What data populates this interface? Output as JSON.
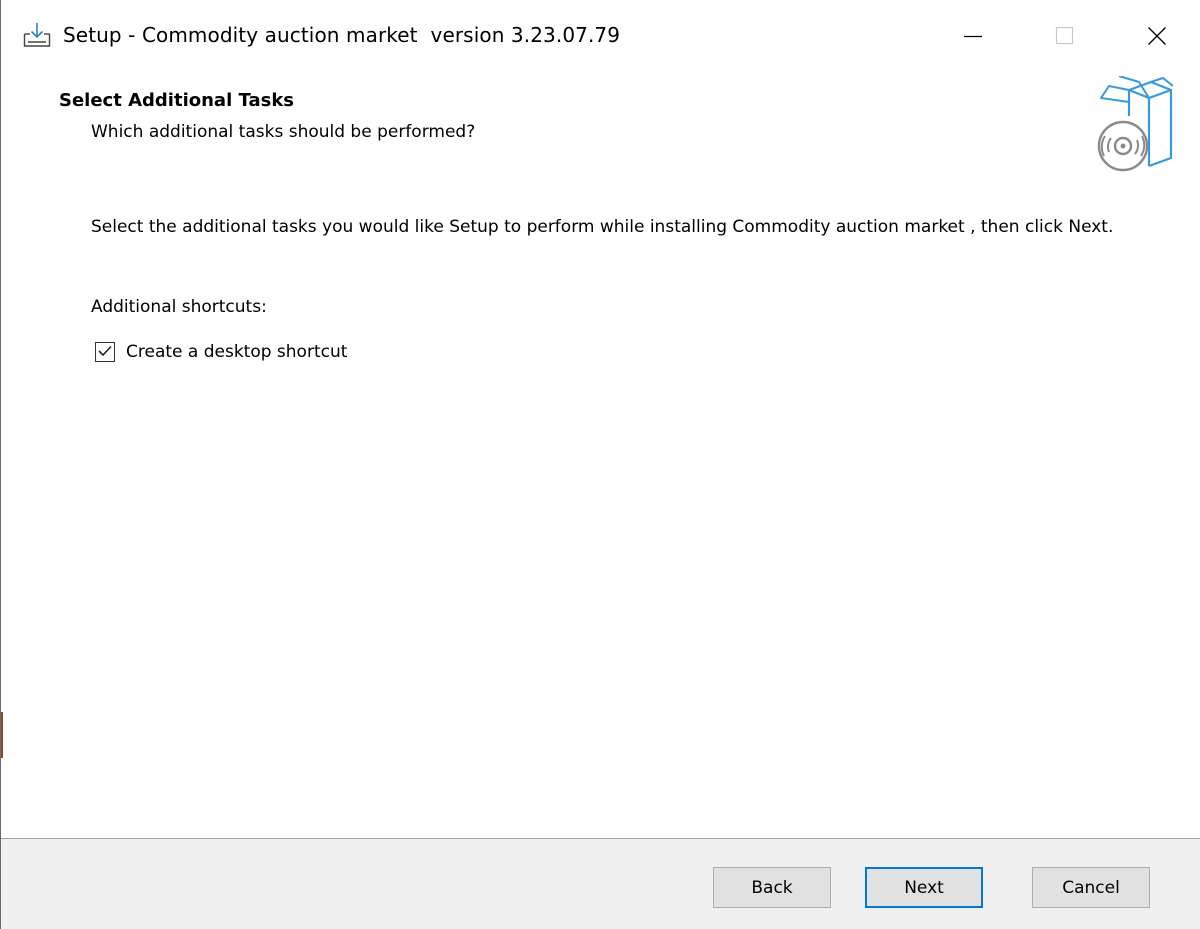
{
  "window": {
    "title": "Setup - Commodity auction market  version 3.23.07.79",
    "controls": {
      "minimize": "minimize-icon",
      "maximize": "maximize-icon",
      "close": "close-icon"
    }
  },
  "header": {
    "title": "Select Additional Tasks",
    "subtitle": "Which additional tasks should be performed?",
    "image": "install-box-disc-icon"
  },
  "body": {
    "description": "Select the additional tasks you would like Setup to perform while installing Commodity auction market , then click Next.",
    "group_label": "Additional shortcuts:",
    "tasks": [
      {
        "label": "Create a desktop shortcut",
        "checked": true
      }
    ]
  },
  "footer": {
    "back_label": "Back",
    "next_label": "Next",
    "cancel_label": "Cancel"
  },
  "colors": {
    "accent": "#0078d7",
    "icon_blue": "#3a9ad9",
    "footer_bg": "#f0f0f0",
    "button_bg": "#e1e1e1"
  }
}
